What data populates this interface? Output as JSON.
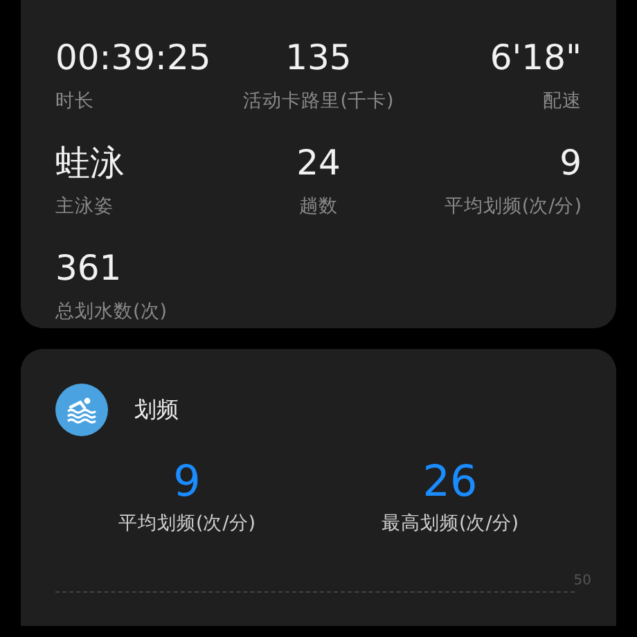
{
  "summary": {
    "stats": [
      {
        "value": "00:39:25",
        "label": "时长"
      },
      {
        "value": "135",
        "label": "活动卡路里(千卡)"
      },
      {
        "value": "6'18\"",
        "label": "配速"
      },
      {
        "value": "蛙泳",
        "label": "主泳姿"
      },
      {
        "value": "24",
        "label": "趟数"
      },
      {
        "value": "9",
        "label": "平均划频(次/分)"
      },
      {
        "value": "361",
        "label": "总划水数(次)"
      }
    ]
  },
  "stroke_rate": {
    "title": "划频",
    "stats": [
      {
        "value": "9",
        "label": "平均划频(次/分)"
      },
      {
        "value": "26",
        "label": "最高划频(次/分)"
      }
    ],
    "axis_label": "50"
  }
}
